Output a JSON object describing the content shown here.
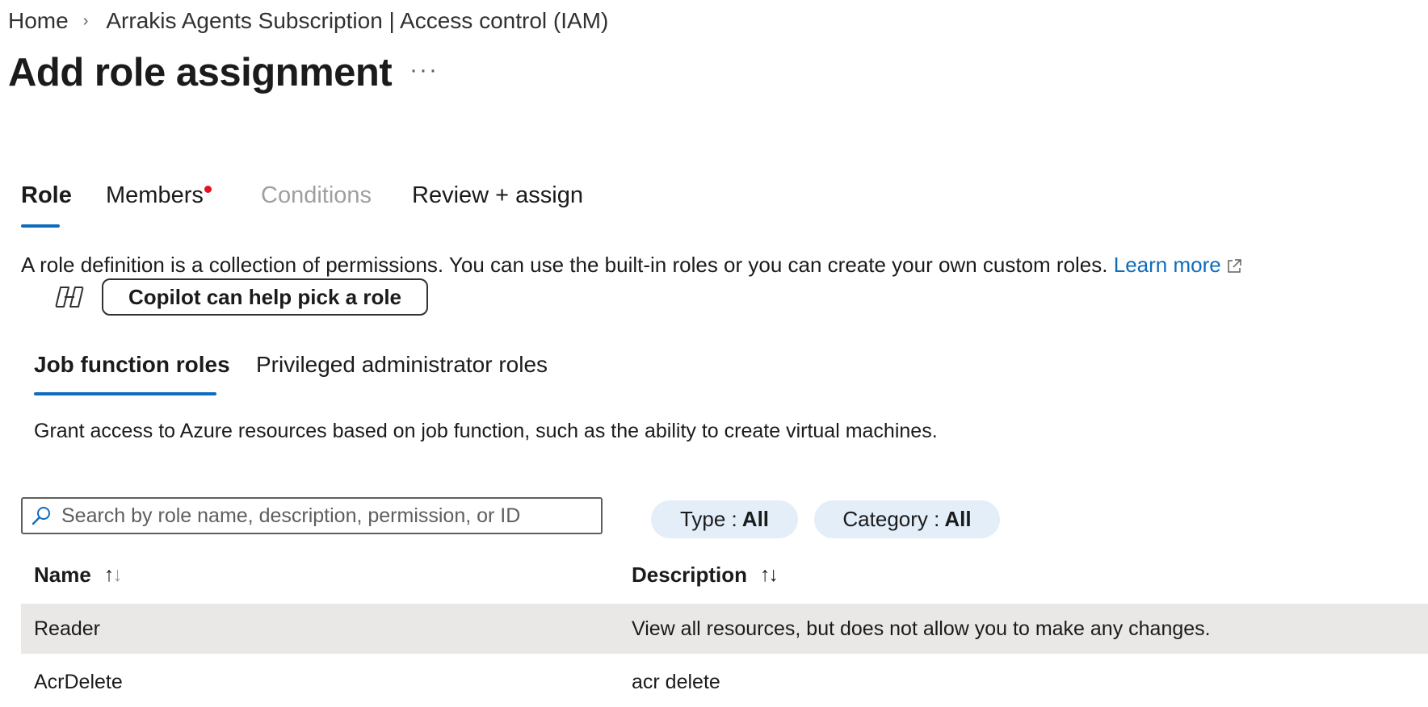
{
  "breadcrumb": {
    "home": "Home",
    "separator": "›",
    "current": "Arrakis Agents Subscription | Access control (IAM)"
  },
  "page": {
    "title": "Add role assignment",
    "more": "···"
  },
  "wizard_tabs": [
    {
      "label": "Role",
      "state": "active"
    },
    {
      "label": "Members",
      "state": "required"
    },
    {
      "label": "Conditions",
      "state": "disabled"
    },
    {
      "label": "Review + assign",
      "state": "normal"
    }
  ],
  "description": {
    "text": "A role definition is a collection of permissions. You can use the built-in roles or you can create your own custom roles.",
    "link": "Learn more"
  },
  "copilot": {
    "icon": "copilot-icon",
    "button_label": "Copilot can help pick a role"
  },
  "role_tabs": [
    {
      "label": "Job function roles",
      "state": "active"
    },
    {
      "label": "Privileged administrator roles",
      "state": "normal"
    }
  ],
  "role_tab_description": "Grant access to Azure resources based on job function, such as the ability to create virtual machines.",
  "search": {
    "placeholder": "Search by role name, description, permission, or ID",
    "value": ""
  },
  "filters": [
    {
      "label": "Type :",
      "value": "All"
    },
    {
      "label": "Category :",
      "value": "All"
    }
  ],
  "table": {
    "columns": [
      {
        "label": "Name"
      },
      {
        "label": "Description"
      }
    ],
    "sort_up": "↑",
    "sort_down": "↓",
    "rows": [
      {
        "name": "Reader",
        "description": "View all resources, but does not allow you to make any changes.",
        "selected": true
      },
      {
        "name": "AcrDelete",
        "description": "acr delete",
        "selected": false
      }
    ]
  },
  "colors": {
    "accent": "#0f6cbd",
    "required_dot": "#e81123",
    "pill_bg": "#e3eef9",
    "selected_row": "#e9e8e6"
  }
}
